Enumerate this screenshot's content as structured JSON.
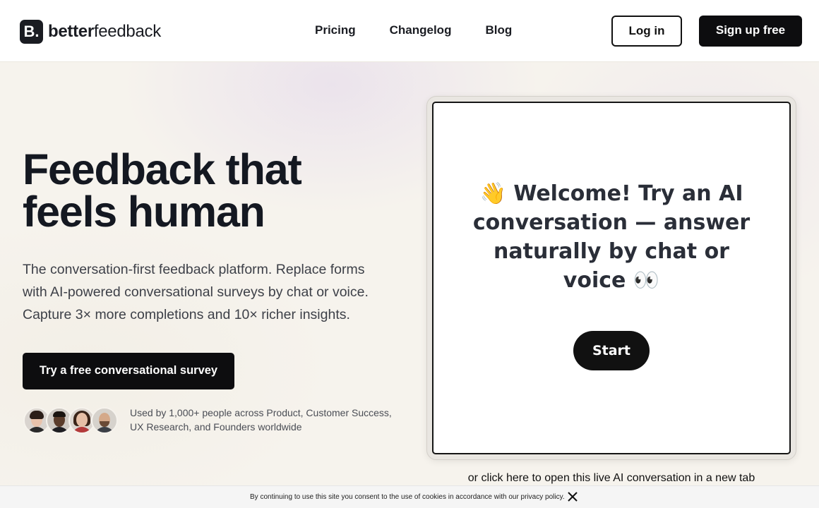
{
  "header": {
    "logo_mark": "B.",
    "logo_bold": "better",
    "logo_light": "feedback",
    "nav": [
      "Pricing",
      "Changelog",
      "Blog"
    ],
    "login_label": "Log in",
    "signup_label": "Sign up free"
  },
  "hero": {
    "title_line1": "Feedback that",
    "title_line2": "feels human",
    "subtitle": "The conversation-first feedback platform. Replace forms with AI-powered conversational surveys by chat or voice. Capture 3× more completions and 10× richer insights.",
    "cta_label": "Try a free conversational survey",
    "social_proof": "Used by 1,000+ people across Product, Customer Success, UX Research, and Founders worldwide",
    "avatars": [
      "avatar-1",
      "avatar-2",
      "avatar-3",
      "avatar-4"
    ]
  },
  "demo_card": {
    "welcome_text": "👋 Welcome! Try an AI conversation — answer naturally by chat or voice 👀",
    "start_label": "Start",
    "open_link": "or click here to open this live AI conversation in a new tab"
  },
  "cookie_bar": {
    "text": "By continuing to use this site you consent to the use of cookies in accordance with our privacy policy.",
    "close_icon": "close-icon"
  },
  "colors": {
    "accent_dark": "#0d0d0f",
    "page_bg": "#f6f3ed",
    "text_primary": "#141821"
  }
}
